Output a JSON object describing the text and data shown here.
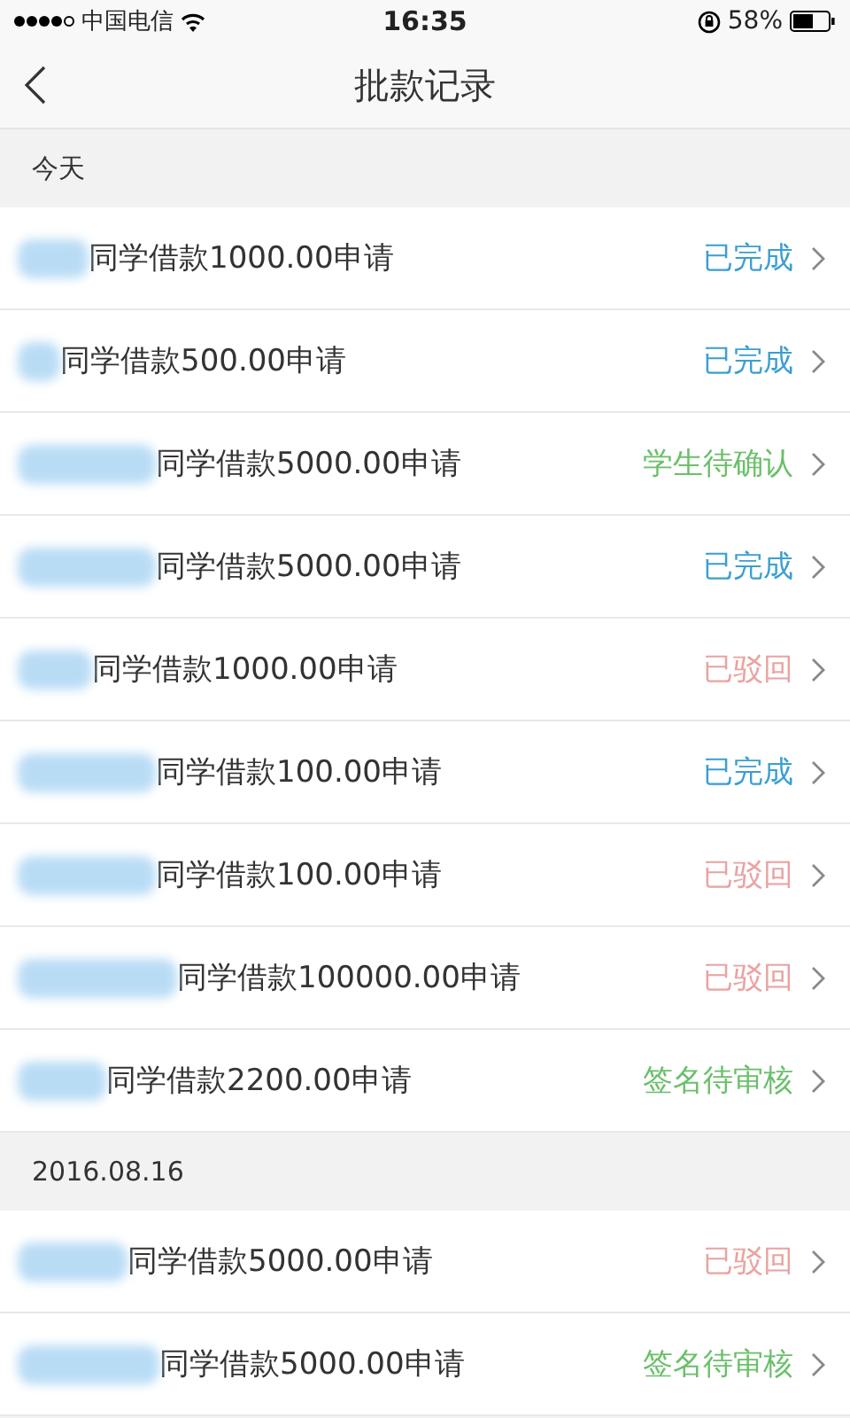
{
  "status_bar": {
    "carrier": "中国电信",
    "time": "16:35",
    "battery": "58%"
  },
  "nav": {
    "title": "批款记录"
  },
  "sections": [
    {
      "header": "今天",
      "rows": [
        {
          "text": "同学借款1000.00申请",
          "status": {
            "kind": "done",
            "text": "已完成"
          }
        },
        {
          "text": "同学借款500.00申请",
          "status": {
            "kind": "done",
            "text": "已完成"
          }
        },
        {
          "text": "同学借款5000.00申请",
          "status": {
            "kind": "pending",
            "text": "学生待确认"
          }
        },
        {
          "text": "同学借款5000.00申请",
          "status": {
            "kind": "done",
            "text": "已完成"
          }
        },
        {
          "text": "同学借款1000.00申请",
          "status": {
            "kind": "rejected",
            "text": "已驳回"
          }
        },
        {
          "text": "同学借款100.00申请",
          "status": {
            "kind": "done",
            "text": "已完成"
          }
        },
        {
          "text": "同学借款100.00申请",
          "status": {
            "kind": "rejected",
            "text": "已驳回"
          }
        },
        {
          "text": "同学借款100000.00申请",
          "status": {
            "kind": "rejected",
            "text": "已驳回"
          }
        },
        {
          "text": "同学借款2200.00申请",
          "status": {
            "kind": "pending",
            "text": "签名待审核"
          }
        }
      ]
    },
    {
      "header": "2016.08.16",
      "rows": [
        {
          "text": "同学借款5000.00申请",
          "status": {
            "kind": "rejected",
            "text": "已驳回"
          }
        },
        {
          "text": "同学借款5000.00申请",
          "status": {
            "kind": "pending",
            "text": "签名待审核"
          }
        }
      ]
    }
  ]
}
